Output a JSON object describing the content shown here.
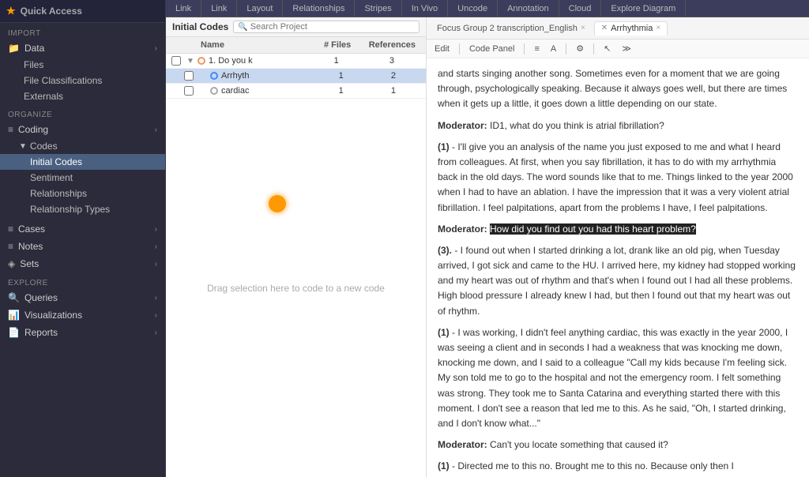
{
  "sidebar": {
    "quick_access_label": "Quick Access",
    "sections": [
      {
        "id": "import",
        "label": "IMPORT",
        "items": [
          {
            "id": "data",
            "label": "Data",
            "icon": "📁",
            "has_children": true,
            "expanded": true
          },
          {
            "id": "files",
            "label": "Files",
            "indent": true
          },
          {
            "id": "file-classifications",
            "label": "File Classifications",
            "indent": true
          },
          {
            "id": "externals",
            "label": "Externals",
            "indent": true
          }
        ]
      },
      {
        "id": "organize",
        "label": "ORGANIZE",
        "items": [
          {
            "id": "coding",
            "label": "Coding",
            "icon": "≡",
            "has_children": true,
            "expanded": true
          },
          {
            "id": "codes",
            "label": "Codes",
            "indent": true,
            "has_children": true,
            "expanded": true
          },
          {
            "id": "initial-codes",
            "label": "Initial Codes",
            "indent2": true,
            "active": true
          },
          {
            "id": "sentiment",
            "label": "Sentiment",
            "indent2": true
          },
          {
            "id": "relationships",
            "label": "Relationships",
            "indent2": true
          },
          {
            "id": "relationship-types",
            "label": "Relationship Types",
            "indent2": true
          }
        ]
      },
      {
        "id": "cases-section",
        "items": [
          {
            "id": "cases",
            "label": "Cases",
            "icon": "≡",
            "has_children": true
          }
        ]
      },
      {
        "id": "notes-section",
        "items": [
          {
            "id": "notes",
            "label": "Notes",
            "icon": "≡",
            "has_children": true
          }
        ]
      },
      {
        "id": "sets-section",
        "items": [
          {
            "id": "sets",
            "label": "Sets",
            "icon": "◈",
            "has_children": true
          }
        ]
      },
      {
        "id": "explore",
        "label": "EXPLORE",
        "items": [
          {
            "id": "queries",
            "label": "Queries",
            "icon": "🔍",
            "has_children": true
          },
          {
            "id": "visualizations",
            "label": "Visualizations",
            "icon": "📊",
            "has_children": true
          },
          {
            "id": "reports",
            "label": "Reports",
            "icon": "📄",
            "has_children": true
          }
        ]
      }
    ]
  },
  "top_tabs": [
    {
      "id": "link1",
      "label": "Link"
    },
    {
      "id": "link2",
      "label": "Link"
    },
    {
      "id": "layout",
      "label": "Layout"
    },
    {
      "id": "relationships-tab",
      "label": "Relationships"
    },
    {
      "id": "stripes",
      "label": "Stripes"
    },
    {
      "id": "in-vivo",
      "label": "In Vivo"
    },
    {
      "id": "uncode",
      "label": "Uncode"
    },
    {
      "id": "annotation",
      "label": "Annotation"
    },
    {
      "id": "cloud",
      "label": "Cloud"
    },
    {
      "id": "explore-diagram",
      "label": "Explore Diagram"
    }
  ],
  "codes_pane": {
    "title": "Initial Codes",
    "search_placeholder": "Search Project",
    "columns": {
      "name": "Name",
      "files": "# Files",
      "references": "References"
    },
    "rows": [
      {
        "id": "do-you-k",
        "label": "1. Do you k",
        "files": 1,
        "refs": 3,
        "level": "parent",
        "expanded": true
      },
      {
        "id": "arrhyth",
        "label": "Arrhyth",
        "files": 1,
        "refs": 2,
        "level": "child",
        "selected": true
      },
      {
        "id": "cardiac",
        "label": "cardiac",
        "files": 1,
        "refs": 1,
        "level": "child",
        "selected": false
      }
    ],
    "drag_hint": "Drag selection here to code to a new code"
  },
  "text_pane": {
    "tabs": [
      {
        "id": "focus-group",
        "label": "Focus Group 2 transcription_English",
        "active": false,
        "closeable": true
      },
      {
        "id": "arrhythmia",
        "label": "Arrhythmia",
        "active": true,
        "closeable": true
      }
    ],
    "toolbar": {
      "edit": "Edit",
      "code_panel": "Code Panel"
    },
    "content": [
      {
        "id": "p1",
        "type": "body",
        "text": "and starts singing another song. Sometimes even for a moment that we are going through, psychologically speaking. Because it always goes well, but there are times when it gets up a little, it goes down a little depending on our state."
      },
      {
        "id": "p2",
        "type": "moderator",
        "speaker": "Moderator:",
        "text": " ID1, what do you think is atrial fibrillation?"
      },
      {
        "id": "p3",
        "type": "numbered",
        "num": "(1)",
        "text": " - I'll give you an analysis of the name you just exposed to me and what I heard from colleagues. At first, when you say fibrillation, it has to do with my arrhythmia back in the old days. The word sounds like that to me. Things linked to the year 2000 when I had to have an ablation. I have the impression that it was a very violent atrial fibrillation. I feel palpitations, apart from the problems I have, I feel palpitations."
      },
      {
        "id": "p4",
        "type": "moderator-highlight",
        "speaker": "Moderator:",
        "highlight": "How did you find out you had this heart problem?"
      },
      {
        "id": "p5",
        "type": "numbered",
        "num": "(3).",
        "text": " - I found out when I started drinking a lot, drank like an old pig, when Tuesday arrived, I got sick and came to the HU. I arrived here, my kidney had stopped working and my heart was out of rhythm and that's when I found out I had all these problems. High blood pressure I already knew I had, but then I found out that my heart was out of rhythm."
      },
      {
        "id": "p6",
        "type": "numbered",
        "num": "(1)",
        "text": " - I was working, I didn't feel anything cardiac, this was exactly in the year 2000, I was seeing a client and in seconds I had a weakness that was knocking me down, knocking me down, and I said to a colleague \"Call my kids because I'm feeling sick. My son told me to go to the hospital and not the emergency room. I felt something was strong. They took me to Santa Catarina and everything started there with this moment. I don't see a reason that led me to this. As he said, \"Oh, I started drinking, and I don't know what...\""
      },
      {
        "id": "p7",
        "type": "moderator",
        "speaker": "Moderator:",
        "text": " Can't you locate something that caused it?"
      },
      {
        "id": "p8",
        "type": "numbered",
        "num": "(1)",
        "text": " - Directed me to this no. Brought me to this no. Because only then I"
      }
    ]
  }
}
